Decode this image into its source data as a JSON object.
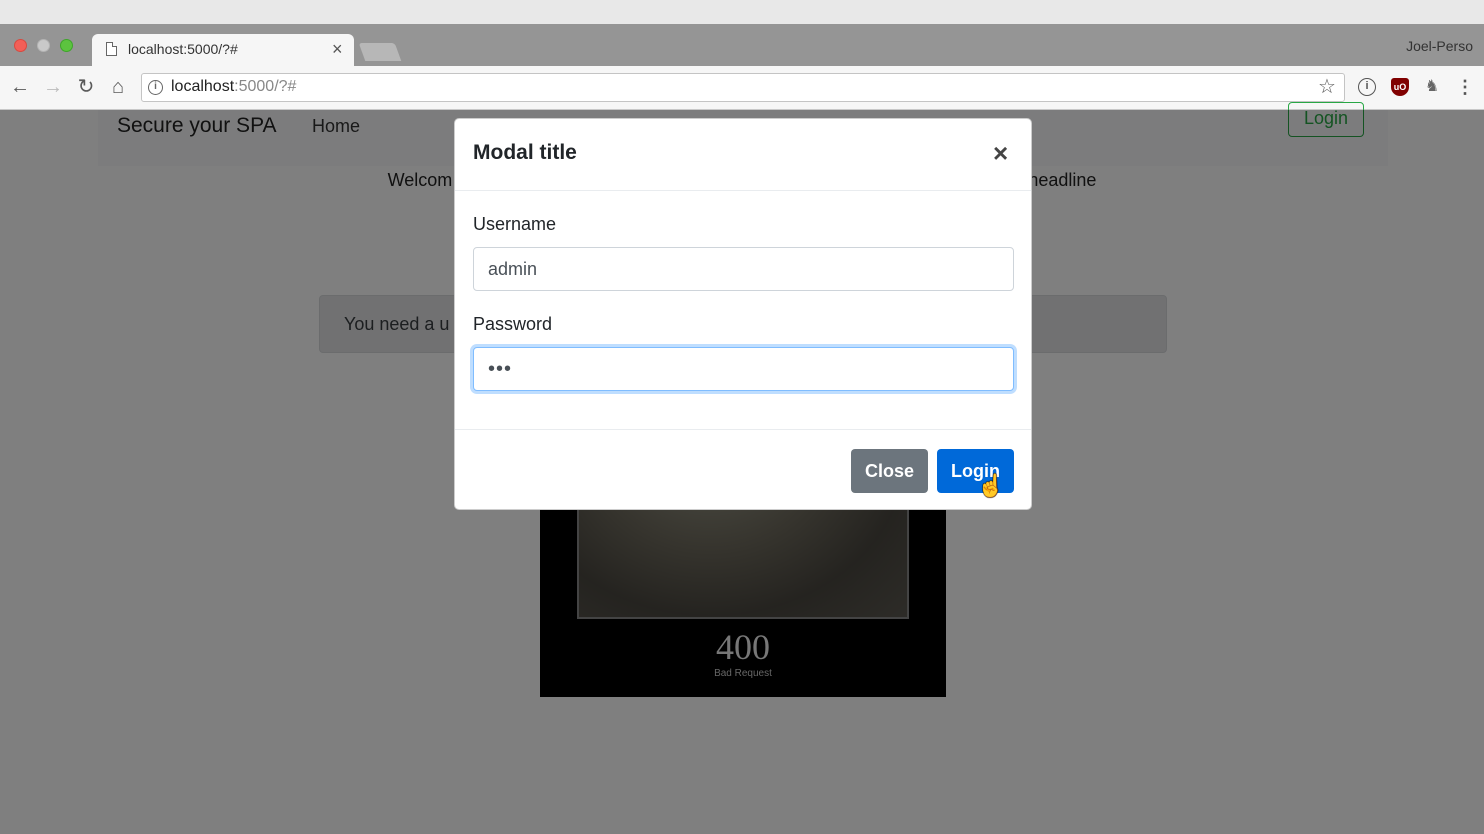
{
  "browser": {
    "tab_title": "localhost:5000/?#",
    "tab_close": "×",
    "profile_name": "Joel-Perso",
    "url_host": "localhost",
    "url_rest": ":5000/?#"
  },
  "page": {
    "brand": "Secure your SPA",
    "nav_home": "Home",
    "nav_login": "Login",
    "welcome_left": "Welcom",
    "welcome_right": "headline",
    "alert_text": "You need a u",
    "poster_code": "400",
    "poster_text": "Bad Request"
  },
  "modal": {
    "title": "Modal title",
    "close_glyph": "×",
    "username_label": "Username",
    "username_value": "admin",
    "password_label": "Password",
    "password_value": "•••",
    "close_button": "Close",
    "login_button": "Login"
  },
  "colors": {
    "primary": "#0069d9",
    "secondary": "#6c757d",
    "success": "#28a745"
  }
}
